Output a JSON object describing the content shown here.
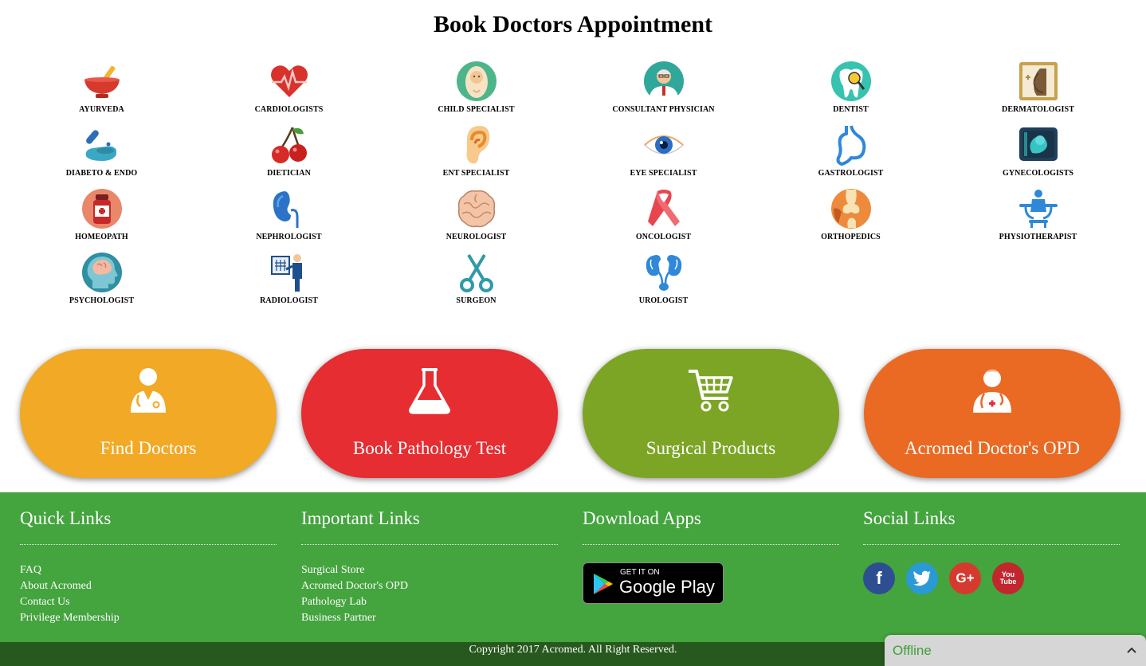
{
  "page": {
    "title": "Book Doctors Appointment"
  },
  "specialties": [
    {
      "label": "AYURVEDA",
      "icon": "ayurveda-icon"
    },
    {
      "label": "CARDIOLOGISTS",
      "icon": "heart-icon"
    },
    {
      "label": "CHILD SPECIALIST",
      "icon": "baby-icon"
    },
    {
      "label": "CONSULTANT PHYSICIAN",
      "icon": "physician-icon"
    },
    {
      "label": "DENTIST",
      "icon": "tooth-icon"
    },
    {
      "label": "DERMATOLOGIST",
      "icon": "skin-icon"
    },
    {
      "label": "DIABETO & ENDO",
      "icon": "insulin-icon"
    },
    {
      "label": "DIETICIAN",
      "icon": "cherry-icon"
    },
    {
      "label": "ENT SPECIALIST",
      "icon": "ear-icon"
    },
    {
      "label": "EYE SPECIALIST",
      "icon": "eye-icon"
    },
    {
      "label": "GASTROLOGIST",
      "icon": "stomach-icon"
    },
    {
      "label": "GYNECOLOGISTS",
      "icon": "fetus-icon"
    },
    {
      "label": "HOMEOPATH",
      "icon": "medicine-bottle-icon"
    },
    {
      "label": "NEPHROLOGIST",
      "icon": "kidney-icon"
    },
    {
      "label": "NEUROLOGIST",
      "icon": "brain-icon"
    },
    {
      "label": "ONCOLOGIST",
      "icon": "ribbon-icon"
    },
    {
      "label": "ORTHOPEDICS",
      "icon": "bone-joint-icon"
    },
    {
      "label": "PHYSIOTHERAPIST",
      "icon": "physio-icon"
    },
    {
      "label": "PSYCHOLOGIST",
      "icon": "head-brain-icon"
    },
    {
      "label": "RADIOLOGIST",
      "icon": "xray-icon"
    },
    {
      "label": "SURGEON",
      "icon": "scissors-icon"
    },
    {
      "label": "UROLOGIST",
      "icon": "urinary-icon"
    }
  ],
  "actions": [
    {
      "label": "Find Doctors",
      "color": "#f2a925",
      "icon": "doctor-icon"
    },
    {
      "label": "Book Pathology Test",
      "color": "#e52d32",
      "icon": "flask-icon"
    },
    {
      "label": "Surgical Products",
      "color": "#7ca526",
      "icon": "cart-icon"
    },
    {
      "label": "Acromed Doctor's OPD",
      "color": "#ea6a24",
      "icon": "doctor-stethoscope-icon"
    }
  ],
  "footer": {
    "quick": {
      "title": "Quick Links",
      "links": [
        "FAQ",
        "About Acromed",
        "Contact Us",
        "Privilege Membership"
      ]
    },
    "important": {
      "title": "Important Links",
      "links": [
        "Surgical Store",
        "Acromed Doctor's OPD",
        "Pathology Lab",
        "Business Partner"
      ]
    },
    "apps": {
      "title": "Download Apps",
      "badge_small": "GET IT ON",
      "badge_big": "Google Play"
    },
    "social": {
      "title": "Social Links",
      "icons": [
        "facebook-icon",
        "twitter-icon",
        "google-plus-icon",
        "youtube-icon"
      ],
      "glyphs": [
        "f",
        "",
        "G+",
        "You Tube"
      ]
    },
    "copyright": "Copyright 2017 Acromed. All Right Reserved."
  },
  "chat": {
    "status": "Offline"
  },
  "colors": {
    "footer": "#44a43e",
    "copyright_bar": "#27581d",
    "offline_text": "#3da137"
  }
}
